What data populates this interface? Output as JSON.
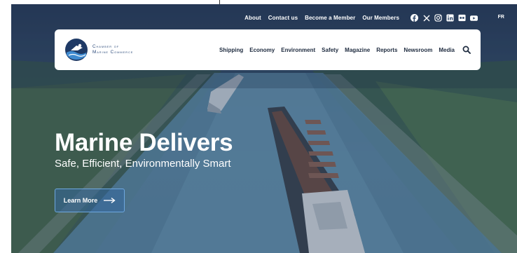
{
  "utility_nav": {
    "links": [
      "About",
      "Contact us",
      "Become a Member",
      "Our Members"
    ],
    "social_icons": [
      "facebook-icon",
      "x-icon",
      "instagram-icon",
      "linkedin-icon",
      "flickr-icon",
      "youtube-icon"
    ],
    "language": "FR"
  },
  "brand": {
    "line1": "Chamber of",
    "line2": "Marine Commerce",
    "color": "#2b4a7a"
  },
  "main_nav": {
    "items": [
      "Shipping",
      "Economy",
      "Environment",
      "Safety",
      "Magazine",
      "Reports",
      "Newsroom",
      "Media"
    ],
    "search_icon": "search-icon"
  },
  "hero": {
    "title": "Marine Delivers",
    "subtitle": "Safe, Efficient, Environmentally Smart",
    "cta_label": "Learn More",
    "cta_icon": "arrow-right-icon",
    "accent": "#6ea8e0"
  }
}
